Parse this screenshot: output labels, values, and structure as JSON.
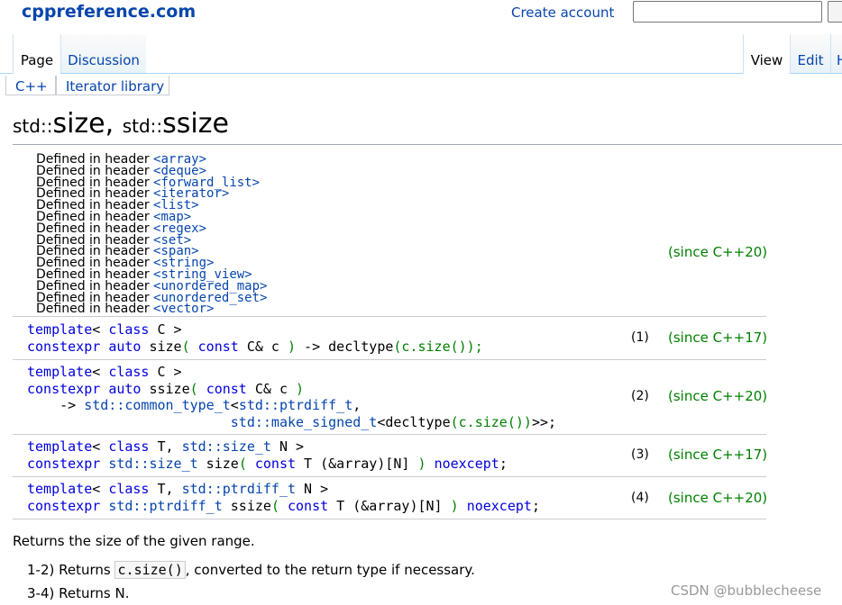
{
  "header": {
    "logo": "cppreference.com",
    "create_account": "Create account",
    "search_placeholder": ""
  },
  "tabs": {
    "page": "Page",
    "discussion": "Discussion",
    "view": "View",
    "edit": "Edit",
    "history": "H"
  },
  "breadcrumb": [
    "C++",
    "Iterator library"
  ],
  "title": {
    "ns1": "std::",
    "name1": "size",
    "comma": ", ",
    "ns2": "std::",
    "name2": "ssize"
  },
  "headers": {
    "prefix": "Defined in header ",
    "items": [
      "<array>",
      "<deque>",
      "<forward_list>",
      "<iterator>",
      "<list>",
      "<map>",
      "<regex>",
      "<set>",
      "<span>",
      "<string>",
      "<string_view>",
      "<unordered_map>",
      "<unordered_set>",
      "<vector>"
    ],
    "since": "(since C++20)"
  },
  "overloads": [
    {
      "num": "(1)",
      "since": "(since C++17)"
    },
    {
      "num": "(2)",
      "since": "(since C++20)"
    },
    {
      "num": "(3)",
      "since": "(since C++17)"
    },
    {
      "num": "(4)",
      "since": "(since C++20)"
    }
  ],
  "code": {
    "template": "template",
    "lt": "< ",
    "class": "class",
    "gt": " >",
    "C": " C",
    "T": " T",
    "comma_sp": ", ",
    "constexpr": "constexpr",
    "auto": "auto",
    "size": " size",
    "ssize": " ssize",
    "lp": "( ",
    "const": "const",
    "Cref": " C& c ",
    "rp": ")",
    "arrow": " -> ",
    "decltype": "decltype",
    "csize": "(c.size());",
    "arrow2": "    -> ",
    "common_type": "std::common_type_t",
    "lt2": "<",
    "ptrdiff_t": "std::ptrdiff_t",
    "comma2": ",",
    "indent": "                         ",
    "make_signed": "std::make_signed_t",
    "decl_tail": "<decltype",
    "csize2": "(c.size())",
    "close2": ">>;",
    "size_t": "std::size_t",
    "N": " N",
    "sp": " ",
    "Tarr": " T (&array)[N] ",
    "noexcept": "noexcept",
    "semi": ";"
  },
  "description": {
    "line1": "Returns the size of the given range.",
    "l2_prefix": "1-2) Returns ",
    "l2_code": "c.size()",
    "l2_suffix": ", converted to the return type if necessary.",
    "l3": "3-4) Returns N."
  },
  "watermark": "CSDN @bubblecheese"
}
